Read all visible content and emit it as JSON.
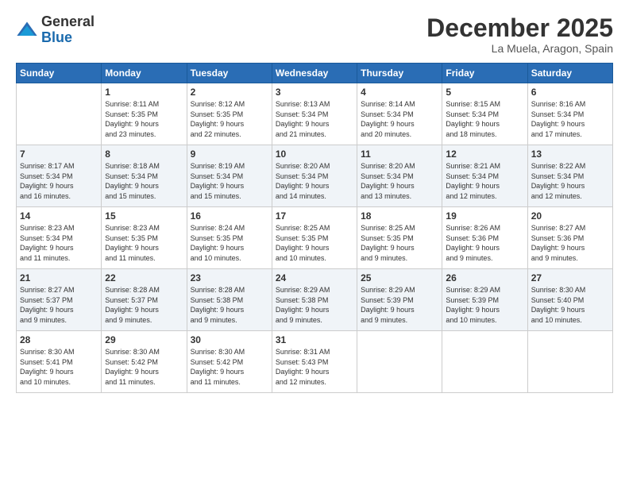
{
  "header": {
    "logo_general": "General",
    "logo_blue": "Blue",
    "month_title": "December 2025",
    "location": "La Muela, Aragon, Spain"
  },
  "weekdays": [
    "Sunday",
    "Monday",
    "Tuesday",
    "Wednesday",
    "Thursday",
    "Friday",
    "Saturday"
  ],
  "weeks": [
    [
      {
        "day": "",
        "info": ""
      },
      {
        "day": "1",
        "info": "Sunrise: 8:11 AM\nSunset: 5:35 PM\nDaylight: 9 hours\nand 23 minutes."
      },
      {
        "day": "2",
        "info": "Sunrise: 8:12 AM\nSunset: 5:35 PM\nDaylight: 9 hours\nand 22 minutes."
      },
      {
        "day": "3",
        "info": "Sunrise: 8:13 AM\nSunset: 5:34 PM\nDaylight: 9 hours\nand 21 minutes."
      },
      {
        "day": "4",
        "info": "Sunrise: 8:14 AM\nSunset: 5:34 PM\nDaylight: 9 hours\nand 20 minutes."
      },
      {
        "day": "5",
        "info": "Sunrise: 8:15 AM\nSunset: 5:34 PM\nDaylight: 9 hours\nand 18 minutes."
      },
      {
        "day": "6",
        "info": "Sunrise: 8:16 AM\nSunset: 5:34 PM\nDaylight: 9 hours\nand 17 minutes."
      }
    ],
    [
      {
        "day": "7",
        "info": "Sunrise: 8:17 AM\nSunset: 5:34 PM\nDaylight: 9 hours\nand 16 minutes."
      },
      {
        "day": "8",
        "info": "Sunrise: 8:18 AM\nSunset: 5:34 PM\nDaylight: 9 hours\nand 15 minutes."
      },
      {
        "day": "9",
        "info": "Sunrise: 8:19 AM\nSunset: 5:34 PM\nDaylight: 9 hours\nand 15 minutes."
      },
      {
        "day": "10",
        "info": "Sunrise: 8:20 AM\nSunset: 5:34 PM\nDaylight: 9 hours\nand 14 minutes."
      },
      {
        "day": "11",
        "info": "Sunrise: 8:20 AM\nSunset: 5:34 PM\nDaylight: 9 hours\nand 13 minutes."
      },
      {
        "day": "12",
        "info": "Sunrise: 8:21 AM\nSunset: 5:34 PM\nDaylight: 9 hours\nand 12 minutes."
      },
      {
        "day": "13",
        "info": "Sunrise: 8:22 AM\nSunset: 5:34 PM\nDaylight: 9 hours\nand 12 minutes."
      }
    ],
    [
      {
        "day": "14",
        "info": "Sunrise: 8:23 AM\nSunset: 5:34 PM\nDaylight: 9 hours\nand 11 minutes."
      },
      {
        "day": "15",
        "info": "Sunrise: 8:23 AM\nSunset: 5:35 PM\nDaylight: 9 hours\nand 11 minutes."
      },
      {
        "day": "16",
        "info": "Sunrise: 8:24 AM\nSunset: 5:35 PM\nDaylight: 9 hours\nand 10 minutes."
      },
      {
        "day": "17",
        "info": "Sunrise: 8:25 AM\nSunset: 5:35 PM\nDaylight: 9 hours\nand 10 minutes."
      },
      {
        "day": "18",
        "info": "Sunrise: 8:25 AM\nSunset: 5:35 PM\nDaylight: 9 hours\nand 9 minutes."
      },
      {
        "day": "19",
        "info": "Sunrise: 8:26 AM\nSunset: 5:36 PM\nDaylight: 9 hours\nand 9 minutes."
      },
      {
        "day": "20",
        "info": "Sunrise: 8:27 AM\nSunset: 5:36 PM\nDaylight: 9 hours\nand 9 minutes."
      }
    ],
    [
      {
        "day": "21",
        "info": "Sunrise: 8:27 AM\nSunset: 5:37 PM\nDaylight: 9 hours\nand 9 minutes."
      },
      {
        "day": "22",
        "info": "Sunrise: 8:28 AM\nSunset: 5:37 PM\nDaylight: 9 hours\nand 9 minutes."
      },
      {
        "day": "23",
        "info": "Sunrise: 8:28 AM\nSunset: 5:38 PM\nDaylight: 9 hours\nand 9 minutes."
      },
      {
        "day": "24",
        "info": "Sunrise: 8:29 AM\nSunset: 5:38 PM\nDaylight: 9 hours\nand 9 minutes."
      },
      {
        "day": "25",
        "info": "Sunrise: 8:29 AM\nSunset: 5:39 PM\nDaylight: 9 hours\nand 9 minutes."
      },
      {
        "day": "26",
        "info": "Sunrise: 8:29 AM\nSunset: 5:39 PM\nDaylight: 9 hours\nand 10 minutes."
      },
      {
        "day": "27",
        "info": "Sunrise: 8:30 AM\nSunset: 5:40 PM\nDaylight: 9 hours\nand 10 minutes."
      }
    ],
    [
      {
        "day": "28",
        "info": "Sunrise: 8:30 AM\nSunset: 5:41 PM\nDaylight: 9 hours\nand 10 minutes."
      },
      {
        "day": "29",
        "info": "Sunrise: 8:30 AM\nSunset: 5:42 PM\nDaylight: 9 hours\nand 11 minutes."
      },
      {
        "day": "30",
        "info": "Sunrise: 8:30 AM\nSunset: 5:42 PM\nDaylight: 9 hours\nand 11 minutes."
      },
      {
        "day": "31",
        "info": "Sunrise: 8:31 AM\nSunset: 5:43 PM\nDaylight: 9 hours\nand 12 minutes."
      },
      {
        "day": "",
        "info": ""
      },
      {
        "day": "",
        "info": ""
      },
      {
        "day": "",
        "info": ""
      }
    ]
  ]
}
